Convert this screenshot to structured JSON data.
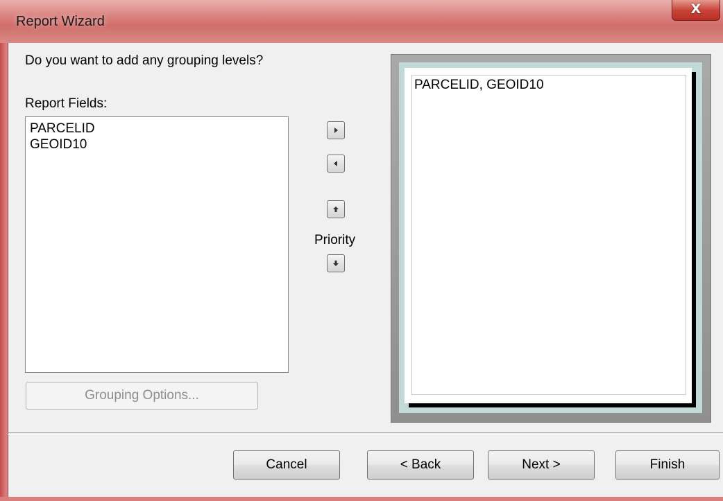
{
  "window": {
    "title": "Report Wizard",
    "close_label": "X"
  },
  "prompt": "Do you want to add any grouping levels?",
  "report_fields": {
    "label": "Report Fields:",
    "items": [
      "PARCELID",
      "GEOID10"
    ]
  },
  "buttons": {
    "grouping_options": "Grouping Options...",
    "cancel": "Cancel",
    "back": "< Back",
    "next": "Next >",
    "finish": "Finish"
  },
  "arrows": {
    "add": "right-arrow-icon",
    "remove": "left-arrow-icon",
    "priority_up": "up-arrow-icon",
    "priority_down": "down-arrow-icon"
  },
  "priority_label": "Priority",
  "preview": {
    "text": "PARCELID, GEOID10"
  },
  "colors": {
    "titlebar": "#d9807d",
    "dialog_bg": "#f0f0f0",
    "preview_mat": "#c2dad7"
  }
}
